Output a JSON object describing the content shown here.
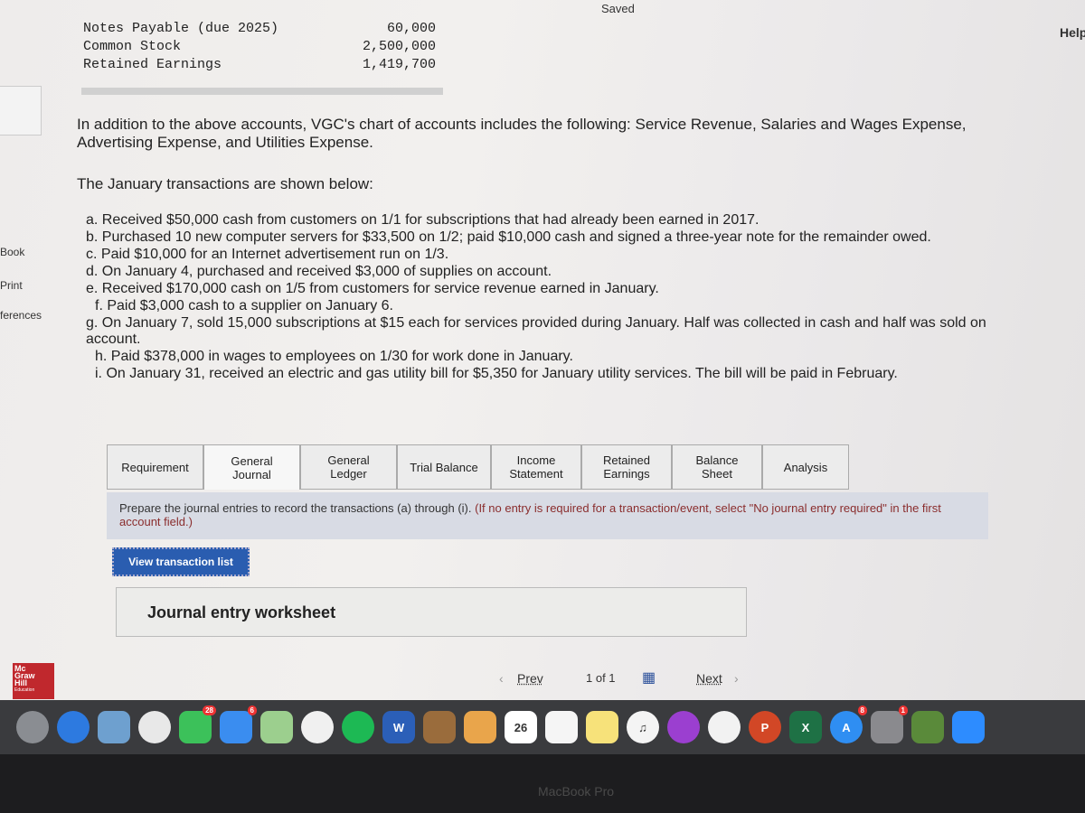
{
  "status": {
    "saved": "Saved",
    "help": "Help"
  },
  "accounts": [
    {
      "name": "Notes Payable (due 2025)",
      "amount": "60,000"
    },
    {
      "name": "Common Stock",
      "amount": "2,500,000"
    },
    {
      "name": "Retained Earnings",
      "amount": "1,419,700"
    }
  ],
  "sidebar": {
    "book": "Book",
    "print": "Print",
    "references": "ferences"
  },
  "intro": "In addition to the above accounts, VGC's chart of accounts includes the following: Service Revenue, Salaries and Wages Expense, Advertising Expense, and Utilities Expense.",
  "transactions_heading": "The January transactions are shown below:",
  "transactions": [
    "a. Received $50,000 cash from customers on 1/1 for subscriptions that had already been earned in 2017.",
    "b. Purchased 10 new computer servers for $33,500 on 1/2; paid $10,000 cash and signed a three-year note for the remainder owed.",
    "c. Paid $10,000 for an Internet advertisement run on 1/3.",
    "d. On January 4, purchased and received $3,000 of supplies on account.",
    "e. Received $170,000 cash on 1/5 from customers for service revenue earned in January.",
    "f. Paid $3,000 cash to a supplier on January 6.",
    "g. On January 7, sold 15,000 subscriptions at $15 each for services provided during January. Half was collected in cash and half was sold on account.",
    "h. Paid $378,000 in wages to employees on 1/30 for work done in January.",
    "i. On January 31, received an electric and gas utility bill for $5,350 for January utility services. The bill will be paid in February."
  ],
  "tabs": [
    "Requirement",
    "General Journal",
    "General Ledger",
    "Trial Balance",
    "Income Statement",
    "Retained Earnings",
    "Balance Sheet",
    "Analysis"
  ],
  "active_tab": "General Journal",
  "instructions": {
    "main": "Prepare the journal entries to record the transactions (a) through (i).",
    "note": "(If no entry is required for a transaction/event, select \"No journal entry required\" in the first account field.)"
  },
  "view_transaction_list": "View transaction list",
  "worksheet_title": "Journal entry worksheet",
  "pager": {
    "prev": "Prev",
    "page": "1 of 1",
    "next": "Next"
  },
  "logo": {
    "lines": [
      "Mc",
      "Graw",
      "Hill"
    ],
    "sub": "Education"
  },
  "dock": [
    {
      "icon": "launchpad-icon",
      "color": "#8a8d92",
      "label": ""
    },
    {
      "icon": "safari-icon",
      "color": "#2d7ae0",
      "label": ""
    },
    {
      "icon": "preview-icon",
      "color": "#6ea0cf",
      "label": ""
    },
    {
      "icon": "chrome-icon",
      "color": "#e8e8e8",
      "label": ""
    },
    {
      "icon": "facetime-icon",
      "color": "#3cc15a",
      "label": "",
      "badge": "28"
    },
    {
      "icon": "messages-icon",
      "color": "#3a8df0",
      "label": "",
      "badge": "6"
    },
    {
      "icon": "maps-icon",
      "color": "#9ccf8e",
      "label": ""
    },
    {
      "icon": "photos-icon",
      "color": "#f0f0f0",
      "label": ""
    },
    {
      "icon": "spotify-icon",
      "color": "#1db954",
      "label": ""
    },
    {
      "icon": "word-icon",
      "color": "#2b5fb8",
      "label": "W"
    },
    {
      "icon": "notefile-icon",
      "color": "#9a6c3c",
      "label": ""
    },
    {
      "icon": "keynote-icon",
      "color": "#e9a54b",
      "label": ""
    },
    {
      "icon": "calendar-icon",
      "color": "#ffffff",
      "label": "26"
    },
    {
      "icon": "reminders-icon",
      "color": "#f5f5f5",
      "label": ""
    },
    {
      "icon": "notes-icon",
      "color": "#f7e27a",
      "label": ""
    },
    {
      "icon": "music-icon",
      "color": "#f4f4f4",
      "label": "♫"
    },
    {
      "icon": "podcasts-icon",
      "color": "#9b3fd0",
      "label": ""
    },
    {
      "icon": "news-icon",
      "color": "#f2f2f2",
      "label": ""
    },
    {
      "icon": "powerpoint-icon",
      "color": "#d24726",
      "label": "P"
    },
    {
      "icon": "excel-icon",
      "color": "#1e7145",
      "label": "X"
    },
    {
      "icon": "app-store-icon",
      "color": "#2f8ef2",
      "label": "A",
      "badge": "8"
    },
    {
      "icon": "system-preferences-icon",
      "color": "#8a8a8e",
      "label": "",
      "badge": "1"
    },
    {
      "icon": "minecraft-icon",
      "color": "#5a8a3a",
      "label": ""
    },
    {
      "icon": "zoom-icon",
      "color": "#2d8cff",
      "label": ""
    }
  ],
  "device": "MacBook Pro"
}
